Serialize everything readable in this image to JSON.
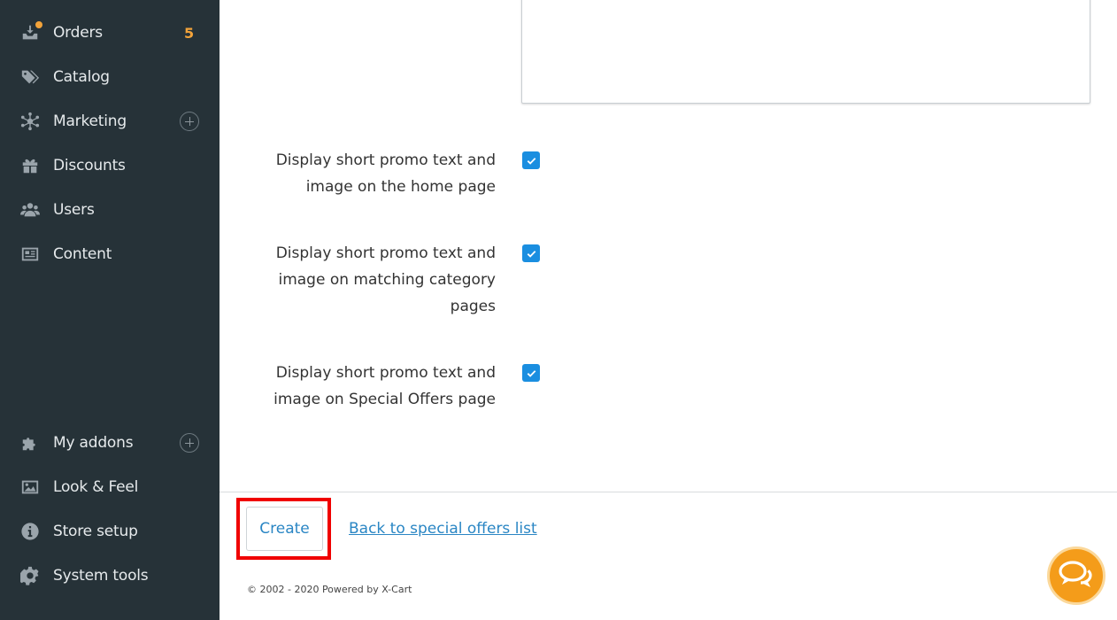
{
  "sidebar": {
    "items": [
      {
        "label": "Orders",
        "icon": "orders-icon",
        "badge": "5"
      },
      {
        "label": "Catalog",
        "icon": "tag-icon"
      },
      {
        "label": "Marketing",
        "icon": "network-icon"
      },
      {
        "label": "Discounts",
        "icon": "gift-icon"
      },
      {
        "label": "Users",
        "icon": "users-icon"
      },
      {
        "label": "Content",
        "icon": "newspaper-icon"
      }
    ],
    "bottom_items": [
      {
        "label": "My addons",
        "icon": "puzzle-icon"
      },
      {
        "label": "Look & Feel",
        "icon": "image-icon"
      },
      {
        "label": "Store setup",
        "icon": "info-icon"
      },
      {
        "label": "System tools",
        "icon": "gear-icon"
      }
    ]
  },
  "form": {
    "options": [
      {
        "line1": "Display short promo text and",
        "line2": "image on the home page",
        "line3": "",
        "checked": true
      },
      {
        "line1": "Display short promo text and",
        "line2": "image on matching category",
        "line3": "pages",
        "checked": true
      },
      {
        "line1": "Display short promo text and",
        "line2": "image on Special Offers page",
        "line3": "",
        "checked": true
      }
    ]
  },
  "footer": {
    "create_label": "Create",
    "back_link": "Back to special offers list",
    "copyright": "© 2002 - 2020 Powered by X-Cart"
  },
  "colors": {
    "sidebar_bg": "#263238",
    "accent_blue": "#1a8ee0",
    "badge_orange": "#f2a33a",
    "highlight_red": "#f00000",
    "chat_orange": "#f49c1a"
  }
}
